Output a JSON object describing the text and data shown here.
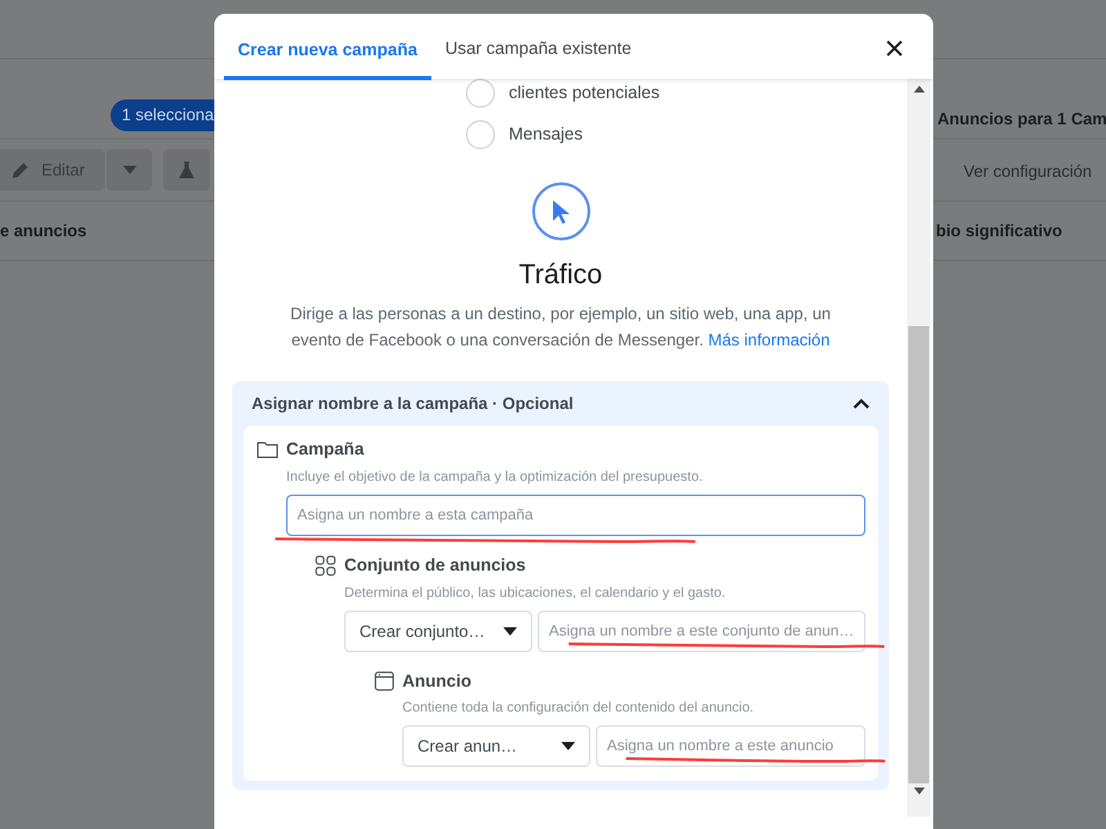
{
  "background": {
    "selection_badge": "1 selecciona",
    "edit_button": "Editar",
    "column_left": "e anuncios",
    "panel_title": "Anuncios para 1 Cam",
    "settings_link": "Ver configuración",
    "column_right": "bio significativo"
  },
  "modal": {
    "tabs": [
      {
        "label": "Crear nueva campaña",
        "selected": true
      },
      {
        "label": "Usar campaña existente",
        "selected": false
      }
    ],
    "objectives": [
      {
        "label": "clientes potenciales",
        "selected": false
      },
      {
        "label": "Mensajes",
        "selected": false
      }
    ],
    "selected_objective": {
      "title": "Tráfico",
      "description": "Dirige a las personas a un destino, por ejemplo, un sitio web, una app, un evento de Facebook o una conversación de Messenger.",
      "link": "Más información"
    },
    "naming_section": {
      "title": "Asignar nombre a la campaña · Opcional",
      "expanded": true,
      "levels": [
        {
          "kind": "campaign",
          "title": "Campaña",
          "description": "Incluye el objetivo de la campaña y la optimización del presupuesto.",
          "placeholder": "Asigna un nombre a esta campaña",
          "focused": true,
          "children": [
            {
              "kind": "ad_set",
              "title": "Conjunto de anuncios",
              "description": "Determina el público, las ubicaciones, el calendario y el gasto.",
              "select": "Crear conjunto…",
              "placeholder": "Asigna un nombre a este conjunto de anun…",
              "focused": false,
              "children": [
                {
                  "kind": "ad",
                  "title": "Anuncio",
                  "description": "Contiene toda la configuración del contenido del anuncio.",
                  "select": "Crear anun…",
                  "placeholder": "Asigna un nombre a este anuncio",
                  "focused": false
                }
              ]
            }
          ]
        }
      ]
    }
  }
}
